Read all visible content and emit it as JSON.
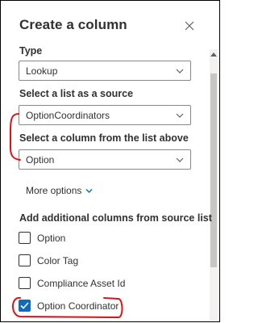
{
  "panel": {
    "title": "Create a column"
  },
  "fields": {
    "type": {
      "label": "Type",
      "value": "Lookup"
    },
    "source_list": {
      "label": "Select a list as a source",
      "value": "OptionCoordinators"
    },
    "source_column": {
      "label": "Select a column from the list above",
      "value": "Option"
    }
  },
  "more_options": {
    "label": "More options"
  },
  "additional": {
    "label": "Add additional columns from source list",
    "items": [
      {
        "label": "Option",
        "checked": false
      },
      {
        "label": "Color Tag",
        "checked": false
      },
      {
        "label": "Compliance Asset Id",
        "checked": false
      },
      {
        "label": "Option Coordinator",
        "checked": true
      }
    ]
  },
  "colors": {
    "accent": "#0f6cbd",
    "annotation": "#e0101a"
  },
  "icons": [
    "close-icon",
    "chevron-down-icon",
    "checkmark-icon",
    "scroll-up-arrow-icon"
  ]
}
